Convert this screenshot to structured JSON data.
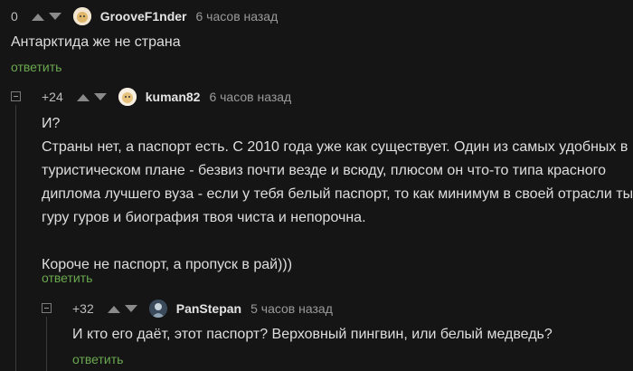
{
  "comments": [
    {
      "rating": "0",
      "user": "GrooveF1nder",
      "time": "6 часов назад",
      "lines": [
        "Антарктида же не страна"
      ],
      "reply": "ответить"
    },
    {
      "rating": "+24",
      "user": "kuman82",
      "time": "6 часов назад",
      "lines": [
        "И?",
        "Страны нет, а паспорт есть. С 2010 года уже как существует. Один из самых удобных в",
        "туристическом плане - безвиз почти везде и всюду, плюсом он что-то типа красного",
        "диплома лучшего вуза - если у тебя белый паспорт, то как минимум в своей отрасли ты",
        "гуру гуров и биография твоя чиста и непорочна.",
        "",
        "Короче не паспорт, а пропуск в рай)))"
      ],
      "reply": "ответить"
    },
    {
      "rating": "+32",
      "user": "PanStepan",
      "time": "5 часов назад",
      "lines": [
        "И кто его даёт, этот паспорт? Верховный пингвин, или белый медведь?"
      ],
      "reply": "ответить"
    }
  ],
  "colors": {
    "background": "#151515",
    "text": "#dedede",
    "reply_link": "#6aa84f",
    "vote_arrow": "#8a8a8a"
  }
}
